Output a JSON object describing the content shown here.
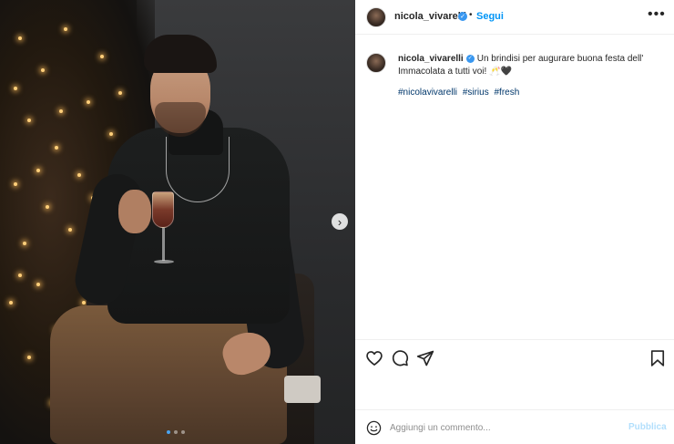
{
  "post": {
    "username": "nicola_vivarelli",
    "verified_badge": "✓",
    "separator": "•",
    "follow_label": "Segui",
    "more_label": "•••",
    "carousel_next": "›",
    "carousel": {
      "total": 3,
      "current": 1
    }
  },
  "caption": {
    "username": "nicola_vivarelli",
    "verified_badge": "✓",
    "text": "Un brindisi per augurare buona festa dell' Immacolata a tutti voi! 🥂🖤",
    "hashtags": [
      "#nicolavivarelli",
      "#sirius",
      "#fresh"
    ]
  },
  "actions": {
    "icons": [
      "heart-icon",
      "comment-icon",
      "share-icon",
      "bookmark-icon"
    ]
  },
  "comment_box": {
    "placeholder": "Aggiungi un commento...",
    "publish_label": "Pubblica"
  },
  "colors": {
    "link_blue": "#0095f6",
    "publish_disabled": "#b2dffc",
    "hashtag": "#00376b",
    "verified": "#3897f0"
  }
}
